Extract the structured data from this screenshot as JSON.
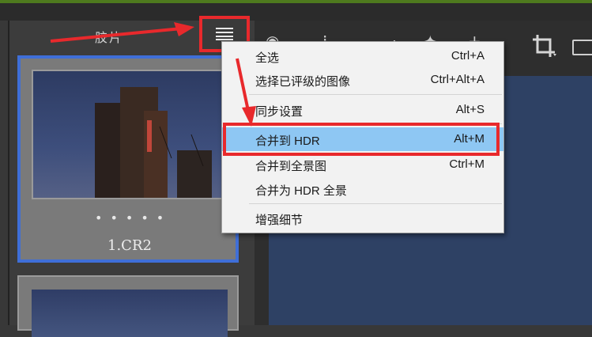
{
  "panel": {
    "title": "胶片"
  },
  "thumbnail": {
    "dots": "•••••",
    "label": "1.CR2"
  },
  "menu": {
    "items": [
      {
        "label": "全选",
        "shortcut": "Ctrl+A"
      },
      {
        "label": "选择已评级的图像",
        "shortcut": "Ctrl+Alt+A"
      },
      {
        "label": "同步设置",
        "shortcut": "Alt+S"
      },
      {
        "label": "合并到 HDR",
        "shortcut": "Alt+M"
      },
      {
        "label": "合并到全景图",
        "shortcut": "Ctrl+M"
      },
      {
        "label": "合并为 HDR 全景",
        "shortcut": ""
      },
      {
        "label": "增强细节",
        "shortcut": ""
      }
    ]
  },
  "colors": {
    "accent": "#e8292c",
    "highlight": "#8ec7f3",
    "selection": "#3f6fd8"
  },
  "icons": [
    "menu-icon",
    "crop-icon",
    "rectangle-icon",
    "toolbar-icons"
  ]
}
